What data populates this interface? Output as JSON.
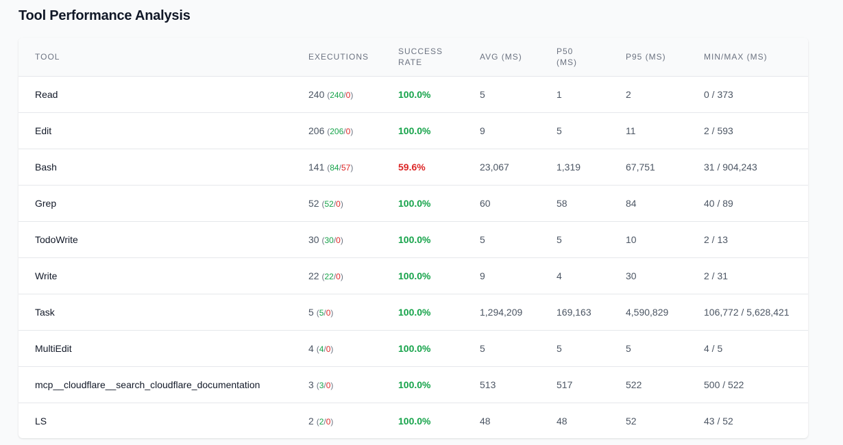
{
  "section": {
    "title": "Tool Performance Analysis"
  },
  "colors": {
    "success": "#16a34a",
    "failure": "#dc2626",
    "header_bg": "#f9fafb"
  },
  "table": {
    "headers": {
      "tool": "TOOL",
      "executions": "EXECUTIONS",
      "success_rate_1": "SUCCESS",
      "success_rate_2": "RATE",
      "avg": "AVG (MS)",
      "p50_1": "P50",
      "p50_2": "(MS)",
      "p95": "P95 (MS)",
      "minmax": "MIN/MAX (MS)"
    },
    "rows": [
      {
        "tool": "Read",
        "executions": "240",
        "ok": "240",
        "fail": "0",
        "rate": "100.0%",
        "rate_status": "good",
        "avg": "5",
        "p50": "1",
        "p95": "2",
        "minmax": "0 / 373"
      },
      {
        "tool": "Edit",
        "executions": "206",
        "ok": "206",
        "fail": "0",
        "rate": "100.0%",
        "rate_status": "good",
        "avg": "9",
        "p50": "5",
        "p95": "11",
        "minmax": "2 / 593"
      },
      {
        "tool": "Bash",
        "executions": "141",
        "ok": "84",
        "fail": "57",
        "rate": "59.6%",
        "rate_status": "warn",
        "avg": "23,067",
        "p50": "1,319",
        "p95": "67,751",
        "minmax": "31 / 904,243"
      },
      {
        "tool": "Grep",
        "executions": "52",
        "ok": "52",
        "fail": "0",
        "rate": "100.0%",
        "rate_status": "good",
        "avg": "60",
        "p50": "58",
        "p95": "84",
        "minmax": "40 / 89"
      },
      {
        "tool": "TodoWrite",
        "executions": "30",
        "ok": "30",
        "fail": "0",
        "rate": "100.0%",
        "rate_status": "good",
        "avg": "5",
        "p50": "5",
        "p95": "10",
        "minmax": "2 / 13"
      },
      {
        "tool": "Write",
        "executions": "22",
        "ok": "22",
        "fail": "0",
        "rate": "100.0%",
        "rate_status": "good",
        "avg": "9",
        "p50": "4",
        "p95": "30",
        "minmax": "2 / 31"
      },
      {
        "tool": "Task",
        "executions": "5",
        "ok": "5",
        "fail": "0",
        "rate": "100.0%",
        "rate_status": "good",
        "avg": "1,294,209",
        "p50": "169,163",
        "p95": "4,590,829",
        "minmax": "106,772 / 5,628,421"
      },
      {
        "tool": "MultiEdit",
        "executions": "4",
        "ok": "4",
        "fail": "0",
        "rate": "100.0%",
        "rate_status": "good",
        "avg": "5",
        "p50": "5",
        "p95": "5",
        "minmax": "4 / 5"
      },
      {
        "tool": "mcp__cloudflare__search_cloudflare_documentation",
        "executions": "3",
        "ok": "3",
        "fail": "0",
        "rate": "100.0%",
        "rate_status": "good",
        "avg": "513",
        "p50": "517",
        "p95": "522",
        "minmax": "500 / 522"
      },
      {
        "tool": "LS",
        "executions": "2",
        "ok": "2",
        "fail": "0",
        "rate": "100.0%",
        "rate_status": "good",
        "avg": "48",
        "p50": "48",
        "p95": "52",
        "minmax": "43 / 52"
      }
    ]
  }
}
